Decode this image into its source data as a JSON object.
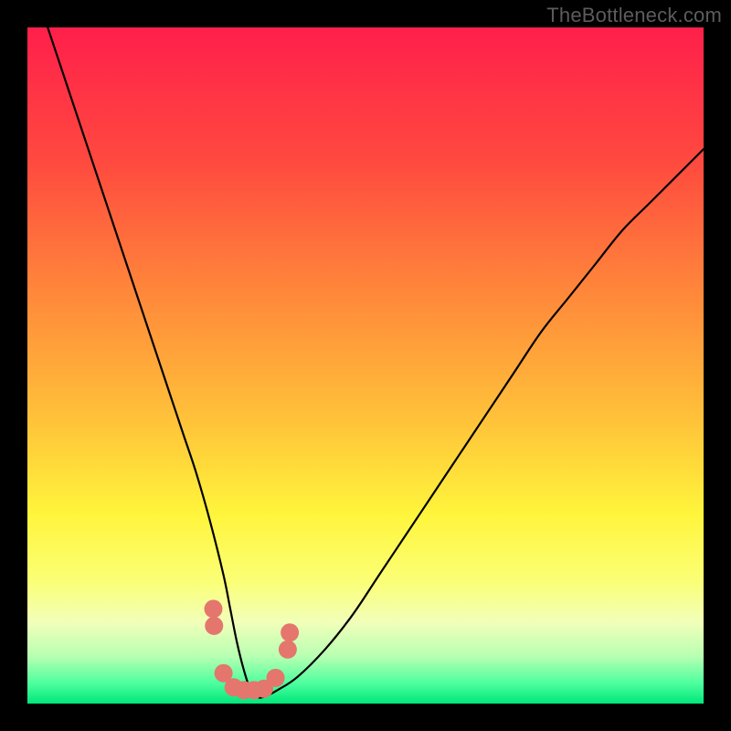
{
  "attribution": "TheBottleneck.com",
  "chart_data": {
    "type": "line",
    "title": "",
    "xlabel": "",
    "ylabel": "",
    "xlim": [
      0,
      100
    ],
    "ylim": [
      0,
      100
    ],
    "gradient_stops": [
      {
        "offset": 0.0,
        "color": "#ff1f4b"
      },
      {
        "offset": 0.2,
        "color": "#ff4a3f"
      },
      {
        "offset": 0.4,
        "color": "#ff8a3a"
      },
      {
        "offset": 0.58,
        "color": "#ffc23a"
      },
      {
        "offset": 0.72,
        "color": "#fff53b"
      },
      {
        "offset": 0.82,
        "color": "#fbff77"
      },
      {
        "offset": 0.88,
        "color": "#f1ffb9"
      },
      {
        "offset": 0.93,
        "color": "#b8ffb2"
      },
      {
        "offset": 0.97,
        "color": "#4dff9e"
      },
      {
        "offset": 1.0,
        "color": "#00e67a"
      }
    ],
    "series": [
      {
        "name": "bottleneck-curve",
        "color": "#000000",
        "x": [
          3,
          5,
          7,
          9,
          11,
          13,
          15,
          17,
          19,
          21,
          23,
          25,
          27,
          29,
          30,
          31,
          32,
          33,
          34,
          35,
          37,
          40,
          44,
          48,
          52,
          56,
          60,
          64,
          68,
          72,
          76,
          80,
          84,
          88,
          92,
          96,
          100
        ],
        "y": [
          100,
          94,
          88,
          82,
          76,
          70,
          64,
          58,
          52,
          46,
          40,
          34,
          27,
          19,
          14,
          9,
          5,
          2,
          1,
          1,
          2,
          4,
          8,
          13,
          19,
          25,
          31,
          37,
          43,
          49,
          55,
          60,
          65,
          70,
          74,
          78,
          82
        ]
      }
    ],
    "data_markers": {
      "color": "#e4766d",
      "points": [
        {
          "x": 27.5,
          "y": 14
        },
        {
          "x": 27.6,
          "y": 11.5
        },
        {
          "x": 29.0,
          "y": 4.5
        },
        {
          "x": 30.5,
          "y": 2.4
        },
        {
          "x": 32.0,
          "y": 2.0
        },
        {
          "x": 33.5,
          "y": 2.0
        },
        {
          "x": 35.0,
          "y": 2.2
        },
        {
          "x": 36.7,
          "y": 3.8
        },
        {
          "x": 38.5,
          "y": 8.0
        },
        {
          "x": 38.8,
          "y": 10.5
        }
      ]
    }
  }
}
